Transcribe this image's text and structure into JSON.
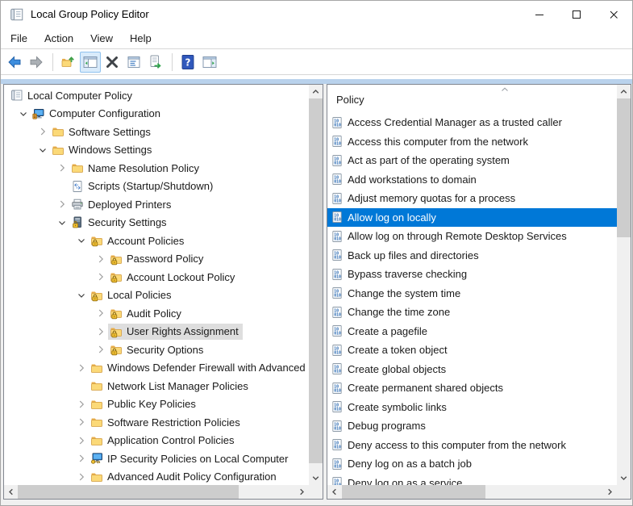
{
  "window": {
    "title": "Local Group Policy Editor",
    "controls": [
      "minimize",
      "maximize",
      "close"
    ]
  },
  "menu": {
    "items": [
      {
        "label": "File"
      },
      {
        "label": "Action"
      },
      {
        "label": "View"
      },
      {
        "label": "Help"
      }
    ]
  },
  "toolbar": {
    "buttons": [
      {
        "name": "back"
      },
      {
        "name": "forward"
      },
      {
        "name": "separator"
      },
      {
        "name": "up-one-level"
      },
      {
        "name": "show-console-tree",
        "checked": true
      },
      {
        "name": "delete"
      },
      {
        "name": "properties"
      },
      {
        "name": "export-list"
      },
      {
        "name": "separator"
      },
      {
        "name": "help"
      },
      {
        "name": "show-action-pane"
      }
    ]
  },
  "tree": {
    "items": [
      {
        "label": "Local Computer Policy",
        "icon": "gpo-scroll",
        "level": 0,
        "expander": "none"
      },
      {
        "label": "Computer Configuration",
        "icon": "computer-config",
        "level": 1,
        "expander": "expanded"
      },
      {
        "label": "Software Settings",
        "icon": "folder",
        "level": 2,
        "expander": "collapsed"
      },
      {
        "label": "Windows Settings",
        "icon": "folder",
        "level": 2,
        "expander": "expanded"
      },
      {
        "label": "Name Resolution Policy",
        "icon": "folder",
        "level": 3,
        "expander": "collapsed"
      },
      {
        "label": "Scripts (Startup/Shutdown)",
        "icon": "scripts",
        "level": 3,
        "expander": "none"
      },
      {
        "label": "Deployed Printers",
        "icon": "printer",
        "level": 3,
        "expander": "collapsed"
      },
      {
        "label": "Security Settings",
        "icon": "server-lock",
        "level": 3,
        "expander": "expanded"
      },
      {
        "label": "Account Policies",
        "icon": "folder-lock",
        "level": 4,
        "expander": "expanded"
      },
      {
        "label": "Password Policy",
        "icon": "folder-lock",
        "level": 5,
        "expander": "collapsed"
      },
      {
        "label": "Account Lockout Policy",
        "icon": "folder-lock",
        "level": 5,
        "expander": "collapsed"
      },
      {
        "label": "Local Policies",
        "icon": "folder-lock",
        "level": 4,
        "expander": "expanded"
      },
      {
        "label": "Audit Policy",
        "icon": "folder-lock",
        "level": 5,
        "expander": "collapsed"
      },
      {
        "label": "User Rights Assignment",
        "icon": "folder-lock",
        "level": 5,
        "expander": "collapsed",
        "selected": true
      },
      {
        "label": "Security Options",
        "icon": "folder-lock",
        "level": 5,
        "expander": "collapsed"
      },
      {
        "label": "Windows Defender Firewall with Advanced Security",
        "icon": "folder",
        "level": 4,
        "expander": "collapsed"
      },
      {
        "label": "Network List Manager Policies",
        "icon": "folder",
        "level": 4,
        "expander": "none"
      },
      {
        "label": "Public Key Policies",
        "icon": "folder",
        "level": 4,
        "expander": "collapsed"
      },
      {
        "label": "Software Restriction Policies",
        "icon": "folder",
        "level": 4,
        "expander": "collapsed"
      },
      {
        "label": "Application Control Policies",
        "icon": "folder",
        "level": 4,
        "expander": "collapsed"
      },
      {
        "label": "IP Security Policies on Local Computer",
        "icon": "ipsec",
        "level": 4,
        "expander": "collapsed"
      },
      {
        "label": "Advanced Audit Policy Configuration",
        "icon": "folder",
        "level": 4,
        "expander": "collapsed"
      }
    ]
  },
  "list": {
    "header": "Policy",
    "items": [
      {
        "label": "Access Credential Manager as a trusted caller"
      },
      {
        "label": "Access this computer from the network"
      },
      {
        "label": "Act as part of the operating system"
      },
      {
        "label": "Add workstations to domain"
      },
      {
        "label": "Adjust memory quotas for a process"
      },
      {
        "label": "Allow log on locally",
        "selected": true
      },
      {
        "label": "Allow log on through Remote Desktop Services"
      },
      {
        "label": "Back up files and directories"
      },
      {
        "label": "Bypass traverse checking"
      },
      {
        "label": "Change the system time"
      },
      {
        "label": "Change the time zone"
      },
      {
        "label": "Create a pagefile"
      },
      {
        "label": "Create a token object"
      },
      {
        "label": "Create global objects"
      },
      {
        "label": "Create permanent shared objects"
      },
      {
        "label": "Create symbolic links"
      },
      {
        "label": "Debug programs"
      },
      {
        "label": "Deny access to this computer from the network"
      },
      {
        "label": "Deny log on as a batch job"
      },
      {
        "label": "Deny log on as a service"
      }
    ]
  },
  "colors": {
    "selection": "#0078D7",
    "inactive_selection": "#DEDEDE",
    "accent_strip": "#B9D2EC"
  }
}
